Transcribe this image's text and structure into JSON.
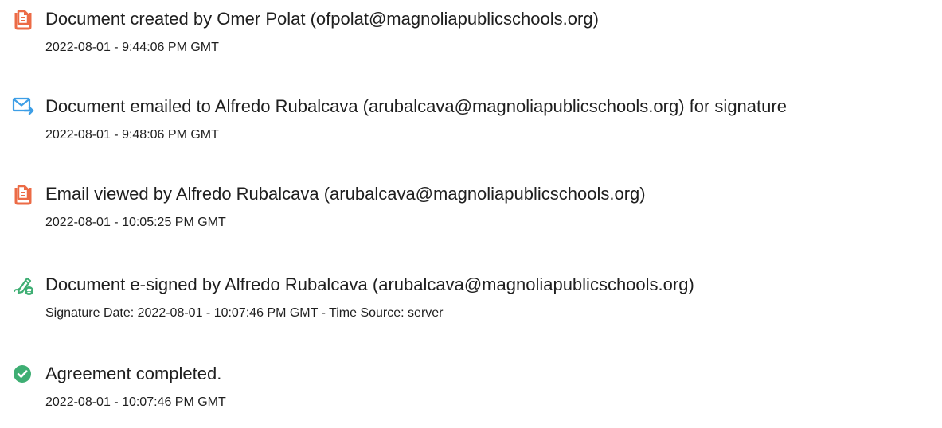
{
  "events": [
    {
      "icon": "document-icon",
      "title": "Document created by Omer Polat (ofpolat@magnoliapublicschools.org)",
      "detail": "2022-08-01 - 9:44:06 PM GMT"
    },
    {
      "icon": "email-sent-icon",
      "title": "Document emailed to Alfredo Rubalcava (arubalcava@magnoliapublicschools.org) for signature",
      "detail": "2022-08-01 - 9:48:06 PM GMT"
    },
    {
      "icon": "document-icon",
      "title": "Email viewed by Alfredo Rubalcava (arubalcava@magnoliapublicschools.org)",
      "detail": "2022-08-01 - 10:05:25 PM GMT"
    },
    {
      "icon": "esign-pen-icon",
      "title": "Document e-signed by Alfredo Rubalcava (arubalcava@magnoliapublicschools.org)",
      "detail": "Signature Date: 2022-08-01 - 10:07:46 PM GMT - Time Source: server"
    },
    {
      "icon": "check-circle-icon",
      "title": "Agreement completed.",
      "detail": "2022-08-01 - 10:07:46 PM GMT"
    }
  ],
  "colors": {
    "document_icon": "#ec6b46",
    "email_icon": "#3d9ee6",
    "esign_icon": "#3eae73",
    "complete_icon": "#3eae73"
  }
}
